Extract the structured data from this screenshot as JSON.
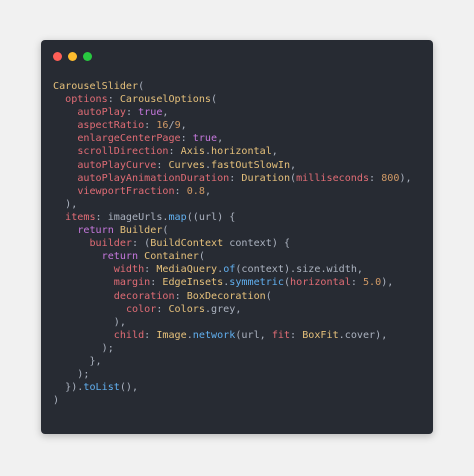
{
  "window": {
    "controls": [
      "close",
      "minimize",
      "maximize"
    ],
    "colors": {
      "close": "#ff5f57",
      "minimize": "#febc2e",
      "maximize": "#28c840"
    }
  },
  "code": {
    "language": "dart",
    "lines": [
      [
        [
          "cls",
          "CarouselSlider"
        ],
        [
          "pun",
          "("
        ]
      ],
      [
        [
          "pun",
          "  "
        ],
        [
          "prop",
          "options"
        ],
        [
          "pun",
          ": "
        ],
        [
          "cls",
          "CarouselOptions"
        ],
        [
          "pun",
          "("
        ]
      ],
      [
        [
          "pun",
          "    "
        ],
        [
          "prop",
          "autoPlay"
        ],
        [
          "pun",
          ": "
        ],
        [
          "kw",
          "true"
        ],
        [
          "pun",
          ","
        ]
      ],
      [
        [
          "pun",
          "    "
        ],
        [
          "prop",
          "aspectRatio"
        ],
        [
          "pun",
          ": "
        ],
        [
          "num",
          "16"
        ],
        [
          "pun",
          "/"
        ],
        [
          "num",
          "9"
        ],
        [
          "pun",
          ","
        ]
      ],
      [
        [
          "pun",
          "    "
        ],
        [
          "prop",
          "enlargeCenterPage"
        ],
        [
          "pun",
          ": "
        ],
        [
          "kw",
          "true"
        ],
        [
          "pun",
          ","
        ]
      ],
      [
        [
          "pun",
          "    "
        ],
        [
          "prop",
          "scrollDirection"
        ],
        [
          "pun",
          ": "
        ],
        [
          "cls",
          "Axis"
        ],
        [
          "pun",
          "."
        ],
        [
          "cls",
          "horizontal"
        ],
        [
          "pun",
          ","
        ]
      ],
      [
        [
          "pun",
          "    "
        ],
        [
          "prop",
          "autoPlayCurve"
        ],
        [
          "pun",
          ": "
        ],
        [
          "cls",
          "Curves"
        ],
        [
          "pun",
          "."
        ],
        [
          "cls",
          "fastOutSlowIn"
        ],
        [
          "pun",
          ","
        ]
      ],
      [
        [
          "pun",
          "    "
        ],
        [
          "prop",
          "autoPlayAnimationDuration"
        ],
        [
          "pun",
          ": "
        ],
        [
          "cls",
          "Duration"
        ],
        [
          "pun",
          "("
        ],
        [
          "prop",
          "milliseconds"
        ],
        [
          "pun",
          ": "
        ],
        [
          "num",
          "800"
        ],
        [
          "pun",
          "),"
        ]
      ],
      [
        [
          "pun",
          "    "
        ],
        [
          "prop",
          "viewportFraction"
        ],
        [
          "pun",
          ": "
        ],
        [
          "num",
          "0.8"
        ],
        [
          "pun",
          ","
        ]
      ],
      [
        [
          "pun",
          "  ),"
        ]
      ],
      [
        [
          "pun",
          "  "
        ],
        [
          "prop",
          "items"
        ],
        [
          "pun",
          ": "
        ],
        [
          "id",
          "imageUrls"
        ],
        [
          "pun",
          "."
        ],
        [
          "fn",
          "map"
        ],
        [
          "pun",
          "(("
        ],
        [
          "id",
          "url"
        ],
        [
          "pun",
          ") {"
        ]
      ],
      [
        [
          "pun",
          "    "
        ],
        [
          "kw",
          "return"
        ],
        [
          "pun",
          " "
        ],
        [
          "cls",
          "Builder"
        ],
        [
          "pun",
          "("
        ]
      ],
      [
        [
          "pun",
          "      "
        ],
        [
          "prop",
          "builder"
        ],
        [
          "pun",
          ": ("
        ],
        [
          "cls",
          "BuildContext"
        ],
        [
          "pun",
          " "
        ],
        [
          "id",
          "context"
        ],
        [
          "pun",
          ") {"
        ]
      ],
      [
        [
          "pun",
          "        "
        ],
        [
          "kw",
          "return"
        ],
        [
          "pun",
          " "
        ],
        [
          "cls",
          "Container"
        ],
        [
          "pun",
          "("
        ]
      ],
      [
        [
          "pun",
          "          "
        ],
        [
          "prop",
          "width"
        ],
        [
          "pun",
          ": "
        ],
        [
          "cls",
          "MediaQuery"
        ],
        [
          "pun",
          "."
        ],
        [
          "fn",
          "of"
        ],
        [
          "pun",
          "("
        ],
        [
          "id",
          "context"
        ],
        [
          "pun",
          ")."
        ],
        [
          "id",
          "size"
        ],
        [
          "pun",
          "."
        ],
        [
          "id",
          "width"
        ],
        [
          "pun",
          ","
        ]
      ],
      [
        [
          "pun",
          "          "
        ],
        [
          "prop",
          "margin"
        ],
        [
          "pun",
          ": "
        ],
        [
          "cls",
          "EdgeInsets"
        ],
        [
          "pun",
          "."
        ],
        [
          "fn",
          "symmetric"
        ],
        [
          "pun",
          "("
        ],
        [
          "prop",
          "horizontal"
        ],
        [
          "pun",
          ": "
        ],
        [
          "num",
          "5.0"
        ],
        [
          "pun",
          "),"
        ]
      ],
      [
        [
          "pun",
          "          "
        ],
        [
          "prop",
          "decoration"
        ],
        [
          "pun",
          ": "
        ],
        [
          "cls",
          "BoxDecoration"
        ],
        [
          "pun",
          "("
        ]
      ],
      [
        [
          "pun",
          "            "
        ],
        [
          "prop",
          "color"
        ],
        [
          "pun",
          ": "
        ],
        [
          "cls",
          "Colors"
        ],
        [
          "pun",
          "."
        ],
        [
          "id",
          "grey"
        ],
        [
          "pun",
          ","
        ]
      ],
      [
        [
          "pun",
          "          ),"
        ]
      ],
      [
        [
          "pun",
          "          "
        ],
        [
          "prop",
          "child"
        ],
        [
          "pun",
          ": "
        ],
        [
          "cls",
          "Image"
        ],
        [
          "pun",
          "."
        ],
        [
          "fn",
          "network"
        ],
        [
          "pun",
          "("
        ],
        [
          "id",
          "url"
        ],
        [
          "pun",
          ", "
        ],
        [
          "prop",
          "fit"
        ],
        [
          "pun",
          ": "
        ],
        [
          "cls",
          "BoxFit"
        ],
        [
          "pun",
          "."
        ],
        [
          "id",
          "cover"
        ],
        [
          "pun",
          "),"
        ]
      ],
      [
        [
          "pun",
          "        );"
        ]
      ],
      [
        [
          "pun",
          "      },"
        ]
      ],
      [
        [
          "pun",
          "    );"
        ]
      ],
      [
        [
          "pun",
          "  })."
        ],
        [
          "fn",
          "toList"
        ],
        [
          "pun",
          "(),"
        ]
      ],
      [
        [
          "pun",
          ")"
        ]
      ]
    ]
  }
}
